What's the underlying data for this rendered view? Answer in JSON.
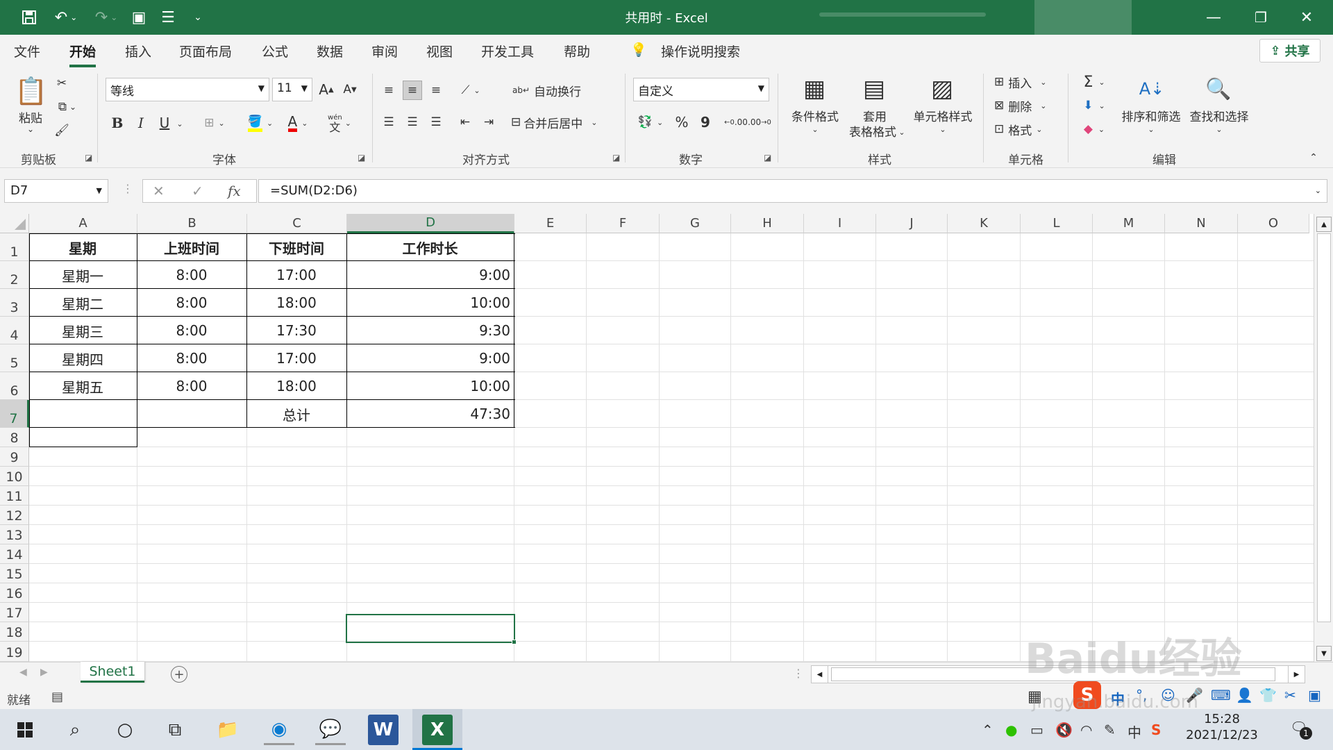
{
  "window": {
    "title": "共用时  -  Excel"
  },
  "tabs": [
    "文件",
    "开始",
    "插入",
    "页面布局",
    "公式",
    "数据",
    "审阅",
    "视图",
    "开发工具",
    "帮助"
  ],
  "tell_me": "操作说明搜索",
  "share_label": "共享",
  "ribbon": {
    "clipboard": {
      "paste": "粘贴",
      "label": "剪贴板"
    },
    "font": {
      "name": "等线",
      "size": "11",
      "bold": "B",
      "italic": "I",
      "underline": "U",
      "grow": "A",
      "shrink": "A",
      "label": "字体",
      "phonetic_top": "wén",
      "phonetic_bottom": "文"
    },
    "alignment": {
      "wrap": "自动换行",
      "merge": "合并后居中",
      "label": "对齐方式"
    },
    "number": {
      "format": "自定义",
      "percent": "%",
      "comma": "9",
      "inc": ".00",
      "dec": ".00",
      "label": "数字"
    },
    "styles": {
      "conditional": "条件格式",
      "table_1": "套用",
      "table_2": "表格格式",
      "cell": "单元格样式",
      "label": "样式"
    },
    "cells": {
      "insert": "插入",
      "delete": "删除",
      "format": "格式",
      "label": "单元格"
    },
    "editing": {
      "sort": "排序和筛选",
      "find": "查找和选择",
      "label": "编辑"
    }
  },
  "formula_bar": {
    "name_box": "D7",
    "formula": "=SUM(D2:D6)",
    "fx": "fx"
  },
  "columns": [
    "A",
    "B",
    "C",
    "D",
    "E",
    "F",
    "G",
    "H",
    "I",
    "J",
    "K",
    "L",
    "M",
    "N",
    "O"
  ],
  "rows": [
    "1",
    "2",
    "3",
    "4",
    "5",
    "6",
    "7",
    "8",
    "9",
    "10",
    "11",
    "12",
    "13",
    "14",
    "15",
    "16",
    "17",
    "18",
    "19"
  ],
  "table": {
    "header": [
      "星期",
      "上班时间",
      "下班时间",
      "工作时长"
    ],
    "data": [
      [
        "星期一",
        "8:00",
        "17:00",
        "9:00"
      ],
      [
        "星期二",
        "8:00",
        "18:00",
        "10:00"
      ],
      [
        "星期三",
        "8:00",
        "17:30",
        "9:30"
      ],
      [
        "星期四",
        "8:00",
        "17:00",
        "9:00"
      ],
      [
        "星期五",
        "8:00",
        "18:00",
        "10:00"
      ],
      [
        "",
        "",
        "总计",
        "47:30"
      ]
    ]
  },
  "sheets": [
    "Sheet1"
  ],
  "status": {
    "ready": "就绪"
  },
  "ime": {
    "mode": "中"
  },
  "clock": {
    "time": "15:28",
    "date": "2021/12/23"
  },
  "tray_ime": "中",
  "notification_count": "1",
  "watermark": {
    "brand": "Baidu经验",
    "url": "jingyan.baidu.com"
  },
  "colors": {
    "excel_green": "#217346",
    "ribbon_bg": "#f3f3f3"
  }
}
